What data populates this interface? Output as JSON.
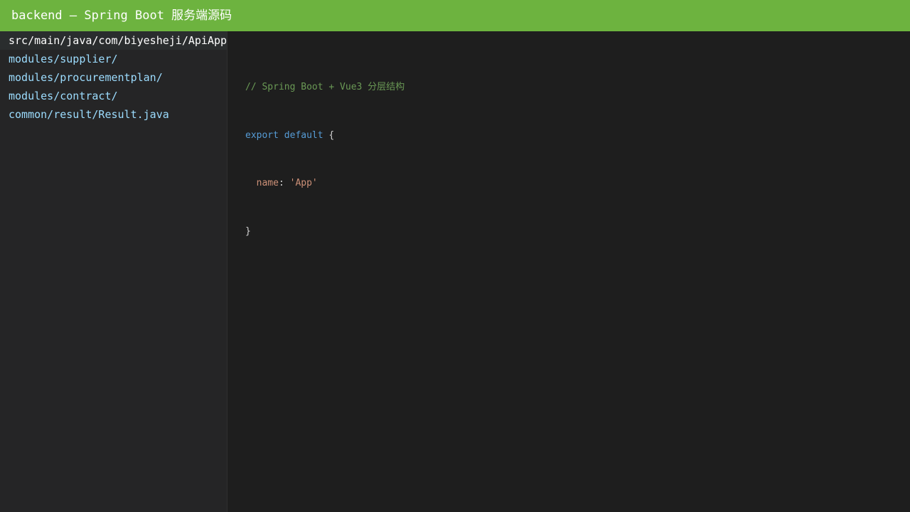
{
  "window": {
    "title": "backend — Spring Boot 服务端源码"
  },
  "sidebar": {
    "items": [
      {
        "label": "src/main/java/com/biyesheji/ApiApplication.java",
        "active": true
      },
      {
        "label": "modules/supplier/",
        "active": false
      },
      {
        "label": "modules/procurementplan/",
        "active": false
      },
      {
        "label": "modules/contract/",
        "active": false
      },
      {
        "label": "common/result/Result.java",
        "active": false
      }
    ]
  },
  "editor": {
    "lines": {
      "l1": {
        "comment": "// Spring Boot + Vue3 分层结构"
      },
      "l2": {
        "kw1": "export",
        "kw2": "default",
        "brace": "{"
      },
      "l3": {
        "prop": "name",
        "colon": ":",
        "value": "'App'"
      },
      "l4": {
        "brace": "}"
      }
    }
  },
  "colors": {
    "titlebar": "#6db33f",
    "sidebar_bg": "#252526",
    "editor_bg": "#1e1e1e",
    "file_link": "#9cdcfe",
    "comment": "#6a9955",
    "keyword": "#569cd6",
    "string": "#ce9178"
  }
}
